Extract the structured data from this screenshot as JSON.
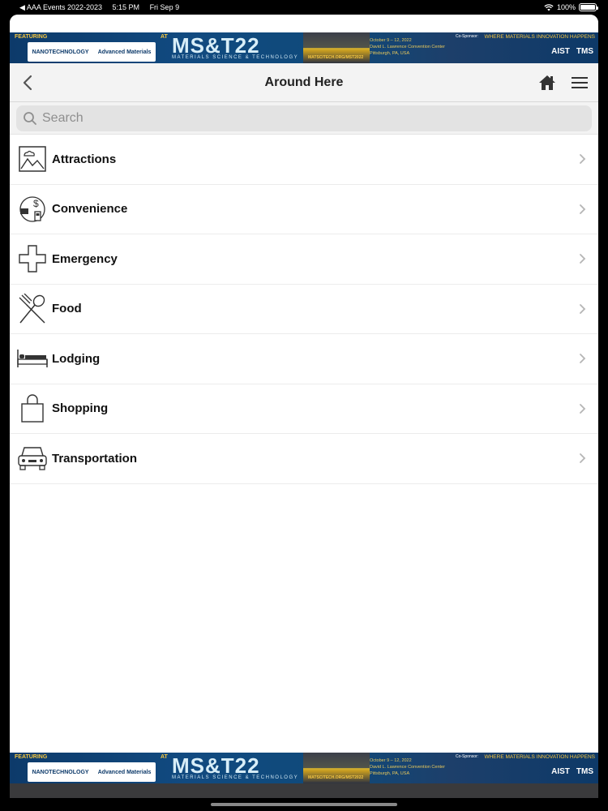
{
  "status": {
    "back_app": "◀ AAA Events 2022-2023",
    "time": "5:15 PM",
    "date": "Fri Sep 9",
    "battery": "100%"
  },
  "banner": {
    "featuring": "FEATURING",
    "nano_show": "NANOTECHNOLOGY",
    "adv_materials": "Advanced Materials",
    "at": "AT",
    "title": "MS&T22",
    "subtitle": "MATERIALS SCIENCE & TECHNOLOGY",
    "url": "MATSCITECH.ORG/MST2022",
    "dates_line1": "October 9 – 12, 2022",
    "dates_line2": "David L. Lawrence Convention Center",
    "dates_line3": "Pittsburgh, PA, USA",
    "cosponsor": "Co-Sponsor:",
    "tagline": "WHERE MATERIALS INNOVATION HAPPENS",
    "logo_aist": "AIST",
    "logo_tms": "TMS"
  },
  "nav": {
    "title": "Around Here"
  },
  "search": {
    "placeholder": "Search"
  },
  "items": [
    {
      "label": "Attractions",
      "icon": "landscape-icon"
    },
    {
      "label": "Convenience",
      "icon": "money-gas-icon"
    },
    {
      "label": "Emergency",
      "icon": "cross-icon"
    },
    {
      "label": "Food",
      "icon": "utensils-icon"
    },
    {
      "label": "Lodging",
      "icon": "bed-icon"
    },
    {
      "label": "Shopping",
      "icon": "shopping-bag-icon"
    },
    {
      "label": "Transportation",
      "icon": "car-icon"
    }
  ]
}
